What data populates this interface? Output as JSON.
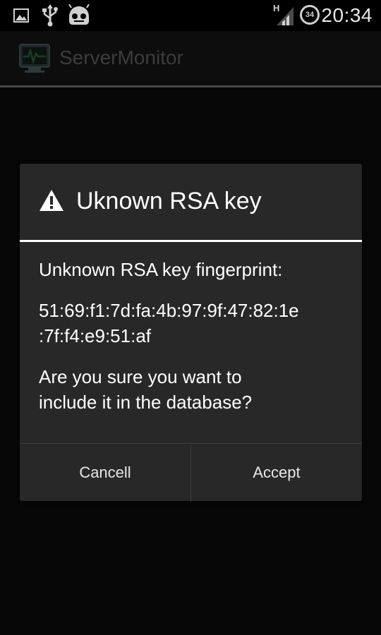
{
  "status_bar": {
    "time": "20:34",
    "notification_badge": "34",
    "network_label": "H",
    "icons": [
      "gallery-icon",
      "usb-icon",
      "cyanogen-mod-icon",
      "signal-icon",
      "sync-badge-icon"
    ]
  },
  "app": {
    "title": "ServerMonitor",
    "icon": "server-monitor-icon"
  },
  "dialog": {
    "title": "Uknown RSA key",
    "icon": "warning-icon",
    "message": {
      "line1": "Unknown RSA key fingerprint:",
      "fingerprint_line1": "51:69:f1:7d:fa:4b:97:9f:47:82:1e",
      "fingerprint_line2": ":7f:f4:e9:51:af",
      "question_line1": "Are you sure you want to",
      "question_line2": "include it in the database?"
    },
    "buttons": {
      "cancel": "Cancell",
      "accept": "Accept"
    }
  },
  "colors": {
    "divider": "#ffffff",
    "dialog_bg": "#282828",
    "status_icon": "#d0d0d0"
  }
}
